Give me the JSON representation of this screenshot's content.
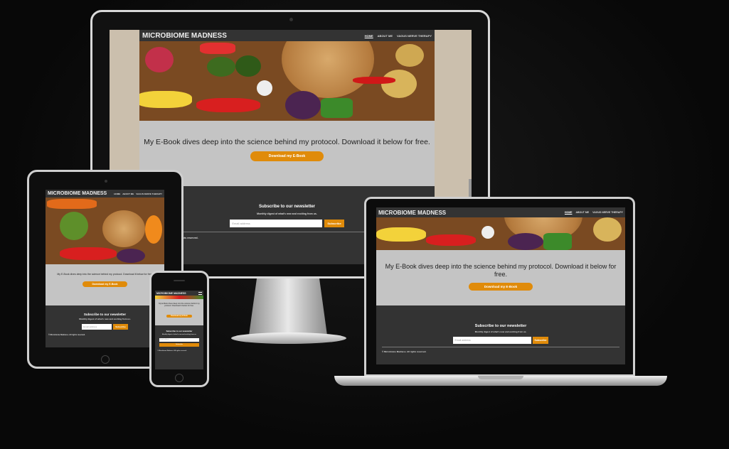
{
  "site": {
    "brand": "MICROBIOME MADNESS",
    "nav": [
      "HOME",
      "ABOUT ME",
      "VAGUS NERVE THERAPY"
    ],
    "ebook_text": "My E-Book dives deep into the science behind my protocol. Download it below for free.",
    "cta_label": "Download my E-Book",
    "newsletter_title": "Subscribe to our newsletter",
    "newsletter_sub": "Monthly digest of what's new and exciting from us.",
    "email_placeholder": "Email address",
    "subscribe_label": "Subscribe",
    "copyright": "© Microbiome Madness. All rights reserved."
  },
  "colors": {
    "accent": "#e08b0a",
    "nav": "#333333",
    "content_bg": "#c4c4c4",
    "page_bg": "#0b0b0b"
  },
  "icons": {
    "menu": "hamburger-icon"
  }
}
